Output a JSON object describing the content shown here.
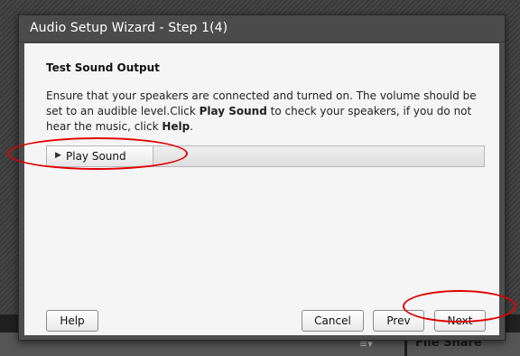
{
  "dialog": {
    "title": "Audio Setup Wizard - Step 1(4)",
    "section_title": "Test Sound Output",
    "instructions": {
      "part1": "Ensure that your speakers are connected and turned on. The volume should be set to an audible level.Click ",
      "bold1": "Play Sound",
      "part2": " to check your speakers, if you do not hear the music, click ",
      "bold2": "Help",
      "part3": "."
    },
    "play_button_label": "Play Sound",
    "buttons": {
      "help": "Help",
      "cancel": "Cancel",
      "prev": "Prev",
      "next": "Next"
    }
  },
  "background": {
    "panel_label": "File Share",
    "menu_icon": "hamburger-menu-icon"
  },
  "colors": {
    "annotation": "#e00000",
    "title_bar": "#4b4b4b",
    "content_bg": "#f5f5f5"
  }
}
